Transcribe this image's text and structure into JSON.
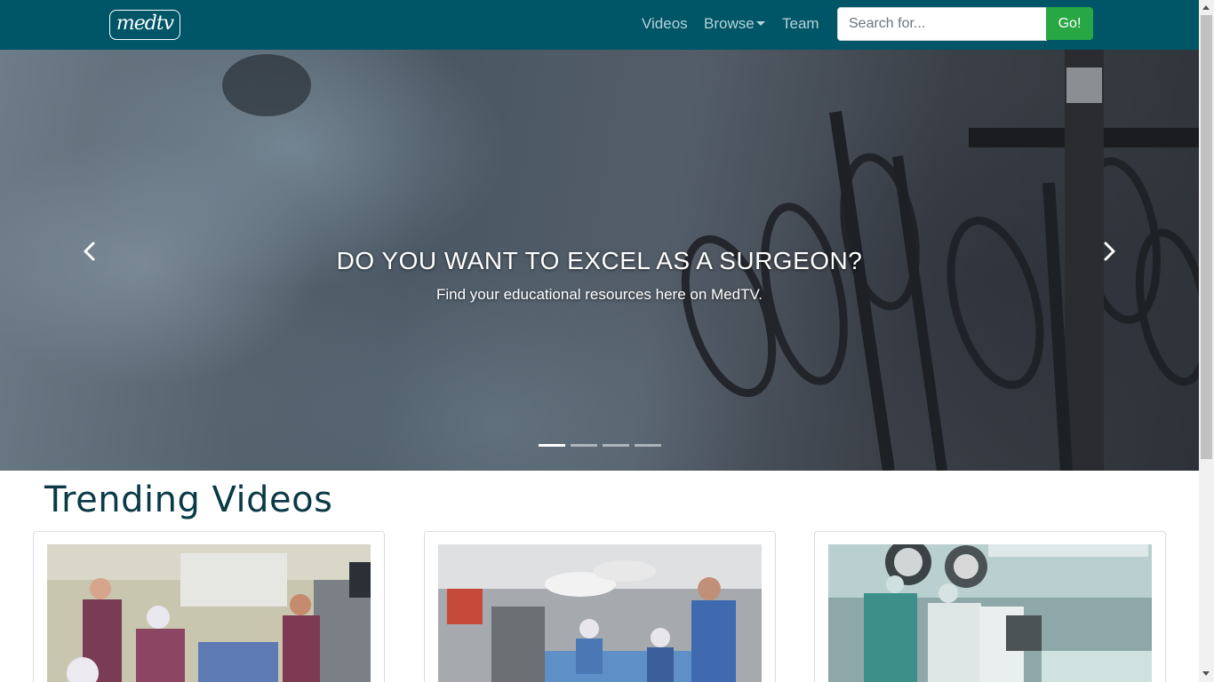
{
  "brand": {
    "logo_text": "medtv"
  },
  "nav": {
    "links": [
      "Videos",
      "Browse",
      "Team"
    ],
    "search_placeholder": "Search for...",
    "search_button": "Go!"
  },
  "hero": {
    "title": "DO YOU WANT TO EXCEL AS A SURGEON?",
    "subtitle": "Find your educational resources here on MedTV.",
    "slide_count": 4,
    "active_slide": 1
  },
  "trending": {
    "heading": "Trending Videos"
  },
  "colors": {
    "navbar": "#005566",
    "nav_link": "#b5d2d8",
    "go_button": "#28a745",
    "heading": "#0b3a47"
  },
  "icons": {
    "prev": "chevron-left-icon",
    "next": "chevron-right-icon"
  }
}
